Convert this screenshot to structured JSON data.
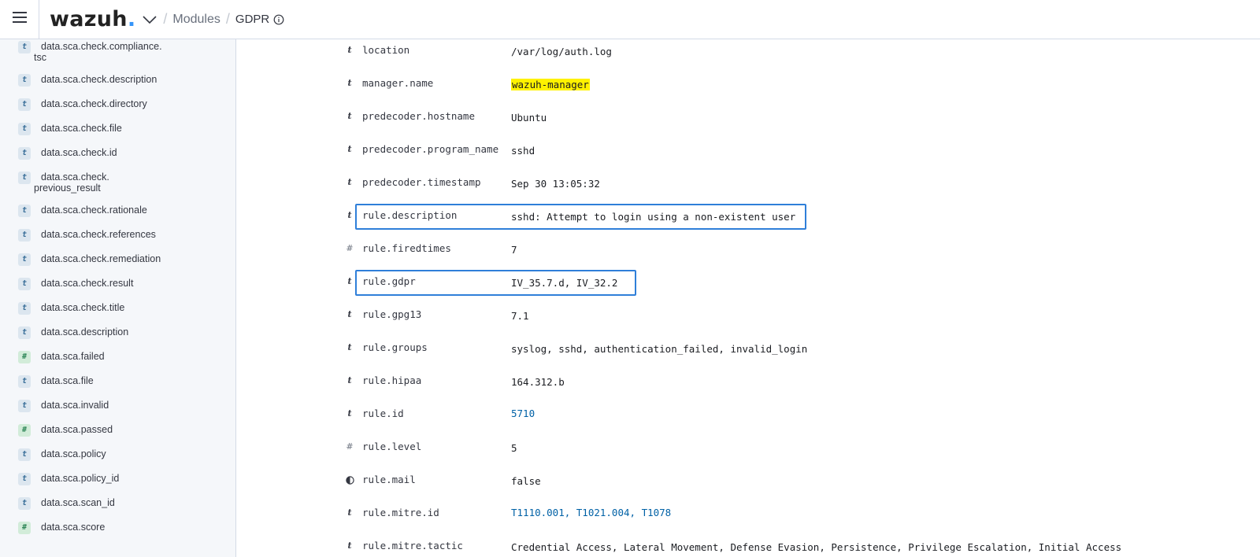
{
  "header": {
    "logo_text": "wazuh",
    "logo_dot": ".",
    "breadcrumb_module": "Modules",
    "breadcrumb_current": "GDPR",
    "menu_icon": "hamburger-icon",
    "dropdown_icon": "chevron-down-icon",
    "info_icon": "info-icon"
  },
  "sidebar": {
    "items": [
      {
        "type": "t",
        "label": "data.sca.check.compliance.",
        "label2": "tsc"
      },
      {
        "type": "t",
        "label": "data.sca.check.description"
      },
      {
        "type": "t",
        "label": "data.sca.check.directory"
      },
      {
        "type": "t",
        "label": "data.sca.check.file"
      },
      {
        "type": "t",
        "label": "data.sca.check.id"
      },
      {
        "type": "t",
        "label": "data.sca.check.",
        "label2": "previous_result"
      },
      {
        "type": "t",
        "label": "data.sca.check.rationale"
      },
      {
        "type": "t",
        "label": "data.sca.check.references"
      },
      {
        "type": "t",
        "label": "data.sca.check.remediation"
      },
      {
        "type": "t",
        "label": "data.sca.check.result"
      },
      {
        "type": "t",
        "label": "data.sca.check.title"
      },
      {
        "type": "t",
        "label": "data.sca.description"
      },
      {
        "type": "#",
        "label": "data.sca.failed"
      },
      {
        "type": "t",
        "label": "data.sca.file"
      },
      {
        "type": "t",
        "label": "data.sca.invalid"
      },
      {
        "type": "#",
        "label": "data.sca.passed"
      },
      {
        "type": "t",
        "label": "data.sca.policy"
      },
      {
        "type": "t",
        "label": "data.sca.policy_id"
      },
      {
        "type": "t",
        "label": "data.sca.scan_id"
      },
      {
        "type": "#",
        "label": "data.sca.score"
      }
    ]
  },
  "fields": [
    {
      "type": "t",
      "name": "location",
      "value": "/var/log/auth.log"
    },
    {
      "type": "t",
      "name": "manager.name",
      "value": "wazuh-manager",
      "highlight": true
    },
    {
      "type": "t",
      "name": "predecoder.hostname",
      "value": "Ubuntu"
    },
    {
      "type": "t",
      "name": "predecoder.program_name",
      "value": "sshd"
    },
    {
      "type": "t",
      "name": "predecoder.timestamp",
      "value": "Sep 30 13:05:32"
    },
    {
      "type": "t",
      "name": "rule.description",
      "value": "sshd: Attempt to login using a non-existent user",
      "boxed": true
    },
    {
      "type": "#",
      "name": "rule.firedtimes",
      "value": "7"
    },
    {
      "type": "t",
      "name": "rule.gdpr",
      "value": "IV_35.7.d, IV_32.2",
      "boxed": true
    },
    {
      "type": "t",
      "name": "rule.gpg13",
      "value": "7.1"
    },
    {
      "type": "t",
      "name": "rule.groups",
      "value": "syslog, sshd, authentication_failed, invalid_login"
    },
    {
      "type": "t",
      "name": "rule.hipaa",
      "value": "164.312.b"
    },
    {
      "type": "t",
      "name": "rule.id",
      "value": "5710",
      "link": true
    },
    {
      "type": "#",
      "name": "rule.level",
      "value": "5"
    },
    {
      "type": "b",
      "name": "rule.mail",
      "value": "false"
    },
    {
      "type": "t",
      "name": "rule.mitre.id",
      "value": "T1110.001, T1021.004, T1078",
      "link": true
    },
    {
      "type": "t",
      "name": "rule.mitre.tactic",
      "value": "Credential Access, Lateral Movement, Defense Evasion, Persistence, Privilege Escalation, Initial Access"
    }
  ],
  "colors": {
    "accent": "#3595f9",
    "box_border": "#2f7fd9",
    "highlight": "#fff200",
    "link": "#0061a6"
  }
}
